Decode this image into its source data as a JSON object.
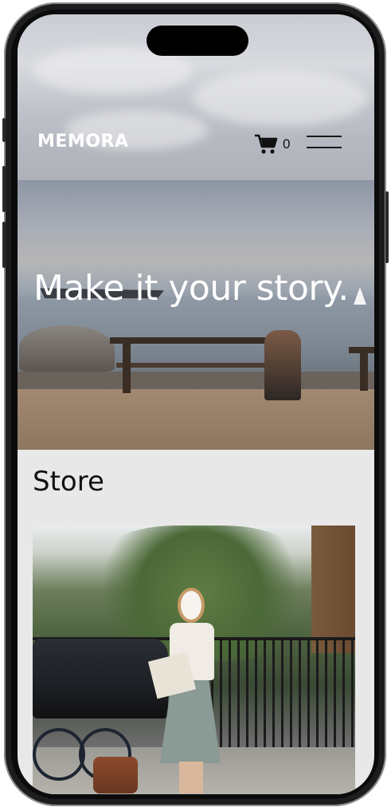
{
  "header": {
    "logo_text": "MEMORA",
    "cart_count": "0",
    "icons": {
      "cart": "cart-icon",
      "menu": "hamburger-menu-icon"
    }
  },
  "hero": {
    "title": "Make it your story."
  },
  "store": {
    "title": "Store"
  },
  "colors": {
    "header_text": "#ffffff",
    "body_background": "#e8e8e8",
    "text_dark": "#111111"
  }
}
